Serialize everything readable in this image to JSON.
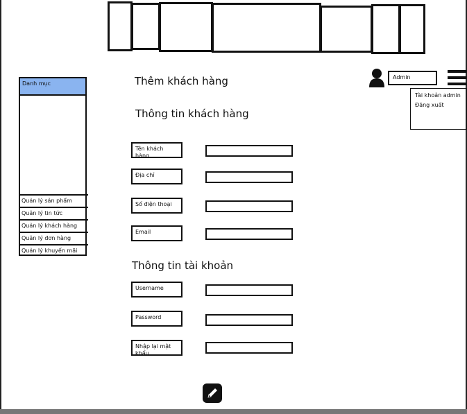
{
  "header": {
    "user_label": "Admin",
    "user_menu": [
      "Tài khoản admin",
      "Đăng xuất"
    ]
  },
  "sidebar": {
    "title": "Danh mục",
    "items": [
      "Quản lý sản phẩm",
      "Quản lý tin tức",
      "Quản lý khách hàng",
      "Quản lý đơn hàng",
      "Quản lý khuyến mãi"
    ]
  },
  "main": {
    "title": "Thêm khách hàng",
    "customer_section": "Thông tin khách hàng",
    "customer_fields": [
      "Tên khách hàng",
      "Địa chỉ",
      "Số điện thoại",
      "Email"
    ],
    "account_section": "Thông tin tài khoản",
    "account_fields": [
      "Username",
      "Password",
      "Nhập lại mật khẩu"
    ]
  },
  "colors": {
    "sidebar_header": "#8ab4f0"
  },
  "icons": {
    "user": "user-icon",
    "menu": "hamburger-icon",
    "submit": "pencil-icon"
  }
}
